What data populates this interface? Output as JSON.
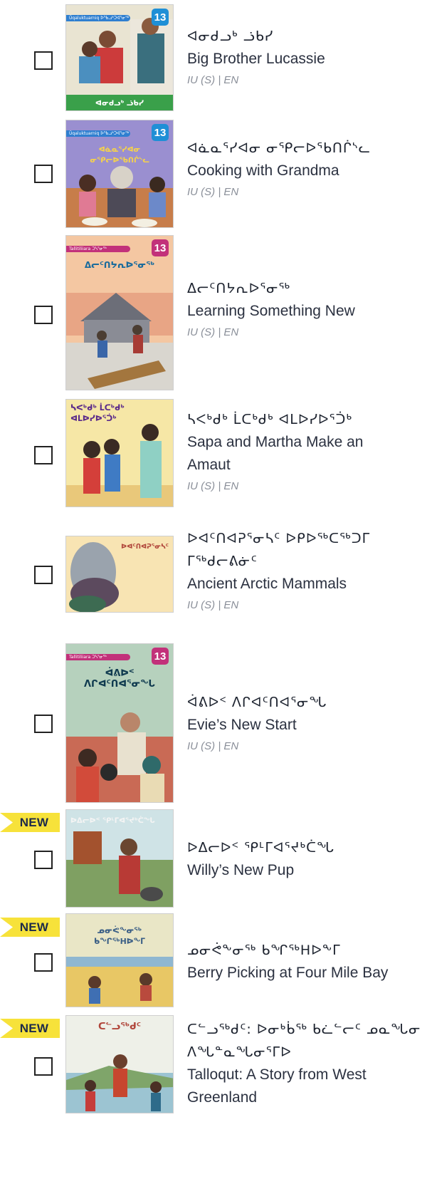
{
  "badge_new_label": "NEW",
  "books": [
    {
      "syllabic_title": "ᐊᓂᑯᓗᒃ ᓘᑲᓯ",
      "english_title": "Big Brother Lucassie",
      "languages": "IU (S) | EN",
      "is_new": false,
      "cover": {
        "level": "13",
        "series": "Ūqaluktuarniq ᐅᖃᓗᒃᑐᐊᕐᓂᖅ",
        "title": "ᐊᓂᑯᓗᒃ ᓘᑲᓯ"
      }
    },
    {
      "syllabic_title": "ᐊᓈᓇᕐᓯᐊᓂ ᓂᕿᓕᐅᕐᑲᑎᒌᔅᓚ",
      "english_title": "Cooking with Grandma",
      "languages": "IU (S) | EN",
      "is_new": false,
      "cover": {
        "level": "13",
        "series": "Ūqaluktuarniq ᐅᖃᓗᒃᑐᐊᕐᓂᖅ",
        "title": "ᐊᓈᓇᕐᓯᐊᓂ ᓂᕿᓕᐅᕐᑲᑎᒌᔅᓚ"
      }
    },
    {
      "syllabic_title": "ᐃᓕᑦᑎᔭᕆᐅᕐᓂᖅ",
      "english_title": "Learning Something New",
      "languages": "IU (S) | EN",
      "is_new": false,
      "cover": {
        "level": "13",
        "series": "Tallitiliiara ᑐᓴᕐᓂᖅ",
        "title": "ᐃᓕᑦᑎᔭᕆᐅᕐᓂᖅ"
      }
    },
    {
      "syllabic_title": "ᓴᐸᒃᑯᒃ ᒫᑕᒃᑯᒃ ᐊᒪᐅᓯᐅᕐᑑᒃ",
      "english_title": "Sapa and Martha Make an Amaut",
      "languages": "IU (S) | EN",
      "is_new": false,
      "cover": {
        "level": "",
        "series": "",
        "title": "ᓴᐸᒃᑯᒃ ᒫᑕᒃᑯᒃ ᐊᒪᐅᓯᐅᕐᑑᒃ"
      }
    },
    {
      "syllabic_title": "ᐅᐊᑦᑎᐊᕈᕐᓂᓴᑦ ᐅᑭᐅᖅᑕᖅᑐᒥ ᒥᖅᑯᓕᕕᓃᑦ",
      "english_title": "Ancient Arctic Mammals",
      "languages": "IU (S) | EN",
      "is_new": false,
      "cover": {
        "level": "",
        "series": "",
        "title": "ᐅᐊᑦᑎᐊᕈᕐᓂᓴᑦ"
      }
    },
    {
      "syllabic_title": "ᐋᕕᐅᑉ ᐱᒋᐊᑦᑎᐊᕐᓂᖓ",
      "english_title": "Evie’s New Start",
      "languages": "IU (S) | EN",
      "is_new": false,
      "cover": {
        "level": "13",
        "series": "Tallitiliiara ᑐᓴᕐᓂᖅ",
        "title": "ᐋᕕᐅᑉ ᐱᒋᐊᑦᑎᐊᕐᓂᖓ"
      }
    },
    {
      "syllabic_title": "ᐅᐃᓕᐅᑉ ᕿᒻᒥᐊᕐᔪᒃᑖᖓ",
      "english_title": "Willy’s New Pup",
      "languages": "",
      "is_new": true,
      "cover": {
        "level": "",
        "series": "",
        "title": "ᐅᐃᓕᐅᑉ ᕿᒻᒥᐊᕐᔪᒃᑖᖓ"
      }
    },
    {
      "syllabic_title": "ᓄᓂᕚᖕᓂᖅ ᑲᖏᖅHᐅᖕᒥ",
      "english_title": "Berry Picking at Four Mile Bay",
      "languages": "",
      "is_new": true,
      "cover": {
        "level": "",
        "series": "",
        "title": "ᓄᓂᕚᖕᓂᖅ ᑲᖏᖅHᐅᖕᒥ"
      }
    },
    {
      "syllabic_title": "ᑕᓪᓗᖅᑯᑦ: ᐅᓂᒃᑳᖅ ᑲᓛᓪᓕᑦ ᓄᓇᖓᓂ ᐱᖓᓐᓇᖓᓂᕐᒥᐅ",
      "english_title": "Talloqut: A Story from West Greenland",
      "languages": "",
      "is_new": true,
      "cover": {
        "level": "",
        "series": "",
        "title": "ᑕᓪᓗᖅᑯᑦ"
      }
    }
  ]
}
